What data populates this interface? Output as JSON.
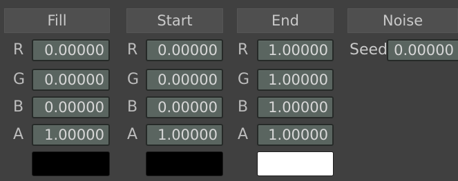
{
  "columns": [
    {
      "header": "Fill",
      "rows": [
        {
          "label": "R",
          "value": "0.00000"
        },
        {
          "label": "G",
          "value": "0.00000"
        },
        {
          "label": "B",
          "value": "0.00000"
        },
        {
          "label": "A",
          "value": "1.00000"
        }
      ],
      "swatch_color": "#000000"
    },
    {
      "header": "Start",
      "rows": [
        {
          "label": "R",
          "value": "0.00000"
        },
        {
          "label": "G",
          "value": "0.00000"
        },
        {
          "label": "B",
          "value": "0.00000"
        },
        {
          "label": "A",
          "value": "1.00000"
        }
      ],
      "swatch_color": "#000000"
    },
    {
      "header": "End",
      "rows": [
        {
          "label": "R",
          "value": "1.00000"
        },
        {
          "label": "G",
          "value": "1.00000"
        },
        {
          "label": "B",
          "value": "1.00000"
        },
        {
          "label": "A",
          "value": "1.00000"
        }
      ],
      "swatch_color": "#ffffff"
    }
  ],
  "noise": {
    "header": "Noise",
    "seed_label": "Seed",
    "seed_value": "0.00000"
  },
  "colors": {
    "background": "#404040",
    "header_bg": "#4f4f4f",
    "field_bg": "#5a6560",
    "text": "#c9c9c9"
  }
}
